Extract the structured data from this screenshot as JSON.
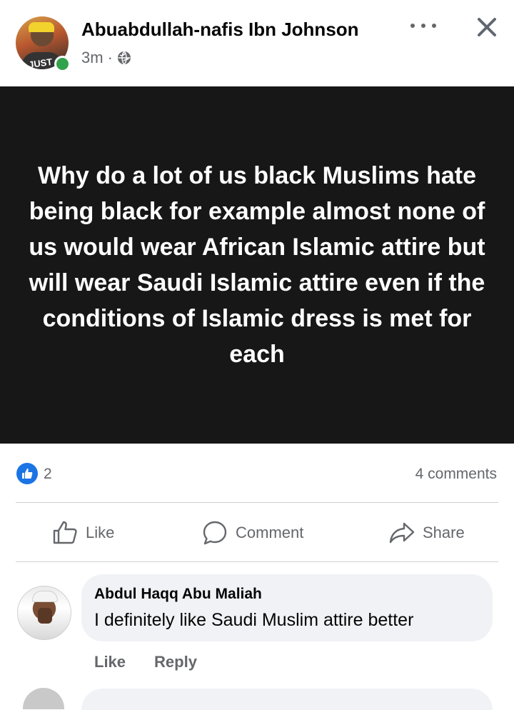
{
  "post": {
    "author_name": "Abuabdullah-nafis Ibn Johnson",
    "timestamp": "3m",
    "separator": "·",
    "privacy_icon": "globe-icon",
    "avatar_shirt_text": "JUST",
    "body_text": "Why do a lot of us black Muslims hate being black for example almost none of us would wear African Islamic attire but will wear Saudi Islamic attire even if the conditions of Islamic dress is met for each",
    "background_color": "#171717"
  },
  "stats": {
    "reaction_count": "2",
    "comments_label": "4 comments"
  },
  "actions": {
    "like_label": "Like",
    "comment_label": "Comment",
    "share_label": "Share"
  },
  "comment": {
    "author": "Abdul Haqq Abu Maliah",
    "text": "I definitely like Saudi Muslim attire better",
    "like_label": "Like",
    "reply_label": "Reply"
  },
  "colors": {
    "accent": "#1b74e4",
    "online": "#31a24c",
    "muted_text": "#65676b",
    "bubble": "#f0f2f5"
  }
}
